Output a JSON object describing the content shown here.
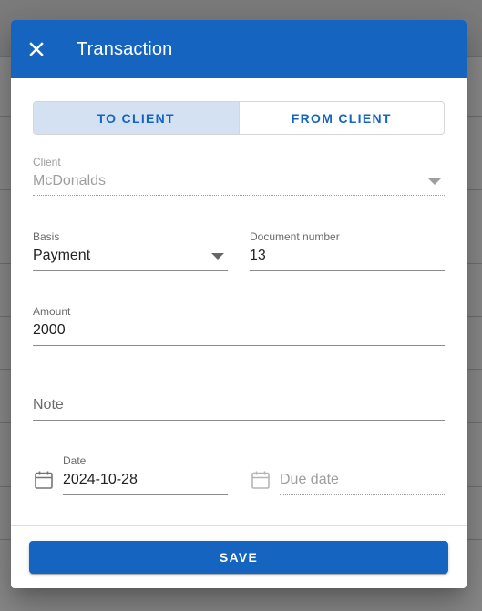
{
  "dialog": {
    "title": "Transaction",
    "close_icon": "close-icon"
  },
  "direction_toggle": {
    "options": [
      {
        "label": "TO CLIENT",
        "active": true
      },
      {
        "label": "FROM CLIENT",
        "active": false
      }
    ]
  },
  "form": {
    "client": {
      "label": "Client",
      "value": "McDonalds",
      "disabled": true
    },
    "basis": {
      "label": "Basis",
      "value": "Payment"
    },
    "document_number": {
      "label": "Document number",
      "value": "13"
    },
    "amount": {
      "label": "Amount",
      "value": "2000"
    },
    "note": {
      "label": "Note",
      "value": ""
    },
    "date": {
      "label": "Date",
      "value": "2024-10-28",
      "icon": "calendar-icon"
    },
    "due_date": {
      "label": "Due date",
      "value": "",
      "icon": "calendar-icon",
      "disabled": true
    }
  },
  "footer": {
    "save_label": "SAVE"
  },
  "colors": {
    "primary": "#1565c0",
    "toggle_active_bg": "#d3e1f3",
    "scrim": "rgba(0,0,0,0.46)"
  }
}
